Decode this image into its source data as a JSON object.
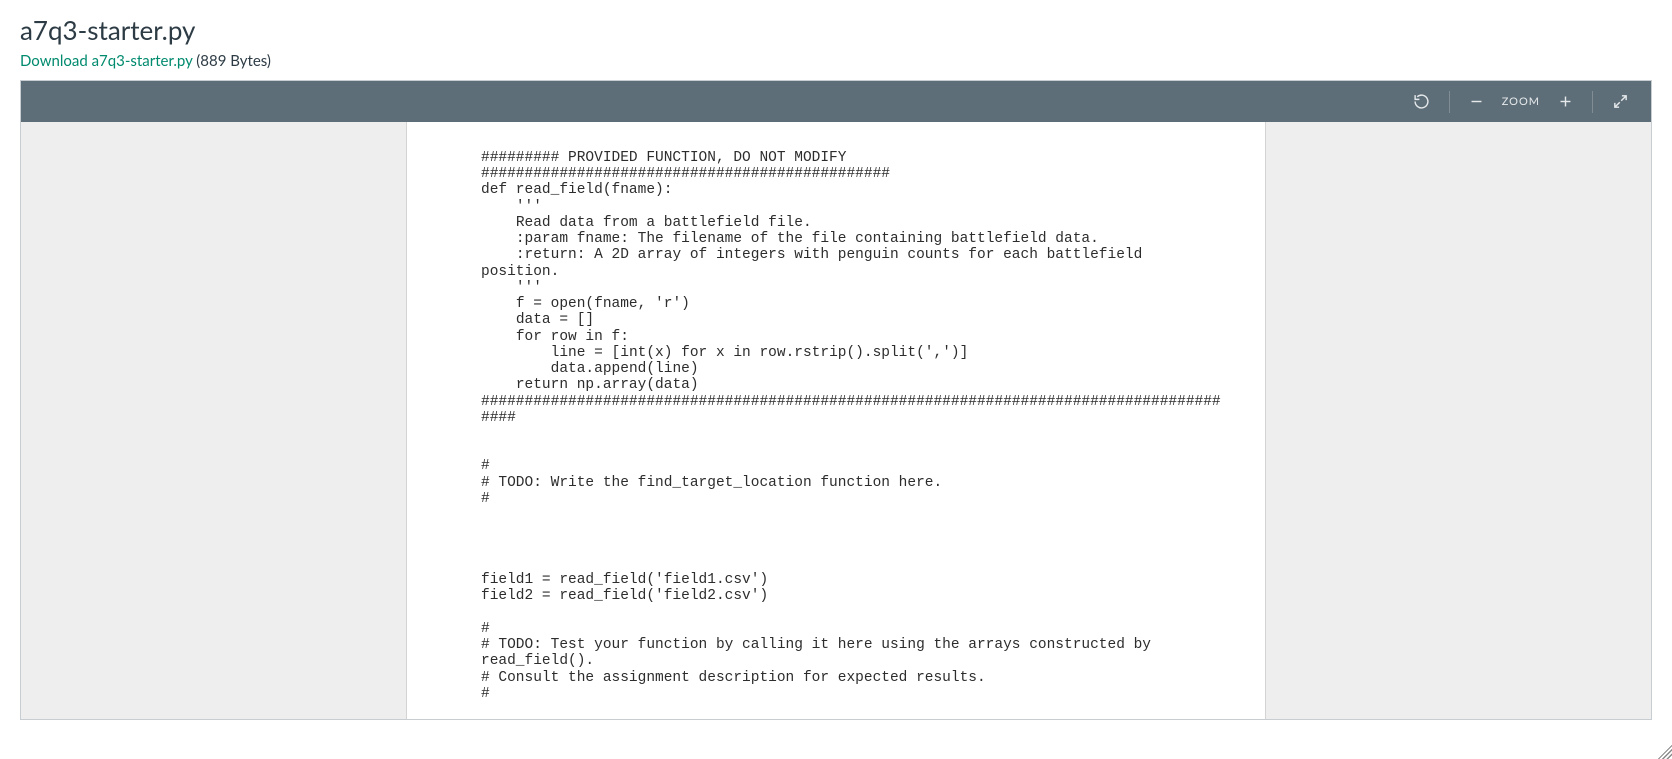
{
  "header": {
    "title": "a7q3-starter.py",
    "download_label": "Download a7q3-starter.py",
    "file_size": "(889 Bytes)"
  },
  "toolbar": {
    "zoom_label": "ZOOM"
  },
  "document": {
    "code": "######### PROVIDED FUNCTION, DO NOT MODIFY\n###############################################\ndef read_field(fname):\n    '''\n    Read data from a battlefield file.\n    :param fname: The filename of the file containing battlefield data.\n    :return: A 2D array of integers with penguin counts for each battlefield position.\n    '''\n    f = open(fname, 'r')\n    data = []\n    for row in f:\n        line = [int(x) for x in row.rstrip().split(',')]\n        data.append(line)\n    return np.array(data)\n#########################################################################################\n\n\n#\n# TODO: Write the find_target_location function here.\n#\n\n\n\n\nfield1 = read_field('field1.csv')\nfield2 = read_field('field2.csv')\n\n#\n# TODO: Test your function by calling it here using the arrays constructed by read_field().\n# Consult the assignment description for expected results.\n#"
  }
}
